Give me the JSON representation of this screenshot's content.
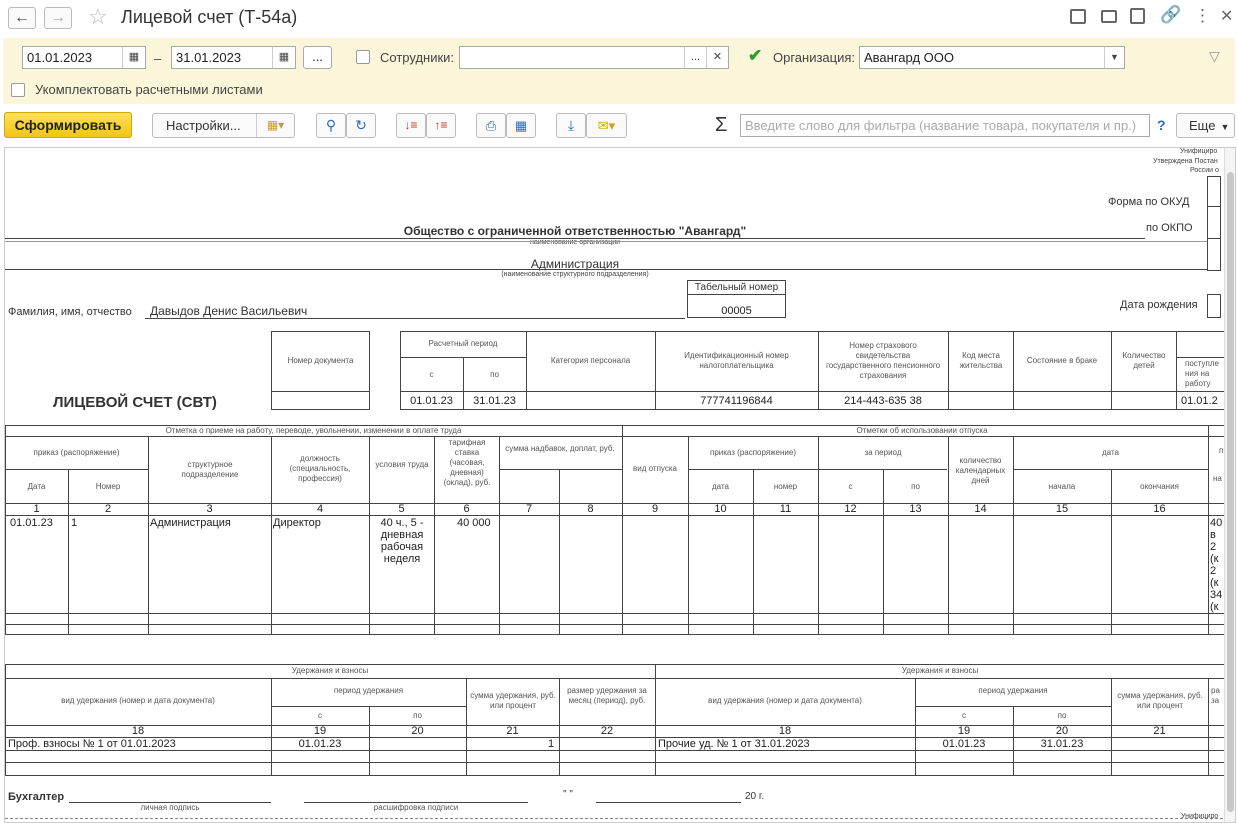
{
  "window": {
    "title": "Лицевой счет (Т-54а)"
  },
  "filters": {
    "date_from": "01.01.2023",
    "dash": "–",
    "date_to": "31.01.2023",
    "dots": "...",
    "employees_label": "Сотрудники:",
    "employees_value": "",
    "org_label": "Организация:",
    "org_value": "Авангард ООО",
    "complete_label": "Укомплектовать расчетными листами",
    "employees_checked": false,
    "org_checked": true,
    "complete_checked": false
  },
  "toolbar": {
    "generate_label": "Сформировать",
    "settings_label": "Настройки...",
    "sum_icon": "Σ",
    "filter_placeholder": "Введите слово для фильтра (название товара, покупателя и пр.)",
    "help": "?",
    "more_label": "Еще"
  },
  "report": {
    "approved": "Унифициро",
    "approved2": "Утверждена Постан",
    "approved3": "России о",
    "form_okud": "Форма по ОКУД",
    "okpo": "по ОКПО",
    "org_name": "Общество с ограниченной ответственностью \"Авангард\"",
    "org_caption": "наименование организации",
    "dept_name": "Администрация",
    "dept_caption": "(наименование структурного подразделения)",
    "tab_num_label": "Табельный номер",
    "tab_num": "00005",
    "fio_label": "Фамилия, имя, отчество",
    "fio": "Давыдов Денис Васильевич",
    "birth_label": "Дата рождения",
    "doc_title": "ЛИЦЕВОЙ СЧЕТ (СВТ)",
    "h_doc_num": "Номер документа",
    "h_period": "Расчетный период",
    "h_from": "с",
    "h_to": "по",
    "h_category": "Категория персонала",
    "h_inn": "Идентификационный номер налогоплательщика",
    "h_snils": "Номер страхового свидетельства государственного пенсионного страхования",
    "h_residence": "Код места жительства",
    "h_marital": "Состояние в браке",
    "h_children": "Количество детей",
    "h_receipt": "поступле ния на работу",
    "period_from": "01.01.23",
    "period_to": "31.01.23",
    "inn": "777741196844",
    "snils": "214-443-635 38",
    "receipt": "01.01.2",
    "s1_title": "Отметка о приеме на работу, переводе, увольнении, изменении в оплате труда",
    "s2_title": "Отметки об использовании отпуска",
    "h_order": "приказ (распоряжение)",
    "h_date": "Дата",
    "h_number": "Номер",
    "h_struct": "структурное подразделение",
    "h_position": "должность (специальность, профессия)",
    "h_conditions": "условия труда",
    "h_rate": "тарифная ставка (часовая, дневная) (оклад), руб.",
    "h_bonus": "сумма надбавок, доплат, руб.",
    "h_vac_type": "вид отпуска",
    "h_order2": "приказ (распоряжение)",
    "h_date2": "дата",
    "h_num2": "номер",
    "h_for_period": "за период",
    "h_from2": "с",
    "h_to2": "по",
    "h_days": "количество календарных дней",
    "h_dates": "дата",
    "h_start": "начала",
    "h_end": "окончания",
    "h_na": "на",
    "h_p": "п",
    "col_nums": [
      "1",
      "2",
      "3",
      "4",
      "5",
      "6",
      "7",
      "8",
      "9",
      "10",
      "11",
      "12",
      "13",
      "14",
      "15",
      "16"
    ],
    "r_date": "01.01.23",
    "r_num": "1",
    "r_dept": "Администрация",
    "r_pos": "Директор",
    "r_cond": "40 ч., 5 - дневная рабочая неделя",
    "r_rate": "40 000",
    "r_right": "40 в 2 (к 2 (к 34 (к",
    "ded_title": "Удержания и взносы",
    "ded_title2": "Удержания и взносы",
    "h_ded_type": "вид удержания (номер и дата документа)",
    "h_ded_period": "период удержания",
    "h_ded_from": "с",
    "h_ded_to": "по",
    "h_ded_sum": "сумма удержания, руб. или процент",
    "h_ded_size": "размер удержания за месяц (период), руб.",
    "h_ded_type2": "вид удержания (номер и дата документа)",
    "h_ded_period2": "период удержания",
    "h_ded_from2": "с",
    "h_ded_to2": "по",
    "h_ded_sum2": "сумма удержания, руб. или процент",
    "h_ded_r": "ра за",
    "d_nums": [
      "18",
      "19",
      "20",
      "21",
      "22",
      "18",
      "19",
      "20",
      "21"
    ],
    "d1_type": "Проф. взносы № 1 от 01.01.2023",
    "d1_from": "01.01.23",
    "d1_sum": "1",
    "d2_type": "Прочие уд. № 1 от 31.01.2023",
    "d2_from": "01.01.23",
    "d2_to": "31.01.23",
    "accountant": "Бухгалтер",
    "sign_caption": "личная подпись",
    "decode_caption": "расшифровка подписи",
    "quote": "\"     \"",
    "year": "20     г.",
    "approved_bottom": "Унифициро"
  }
}
